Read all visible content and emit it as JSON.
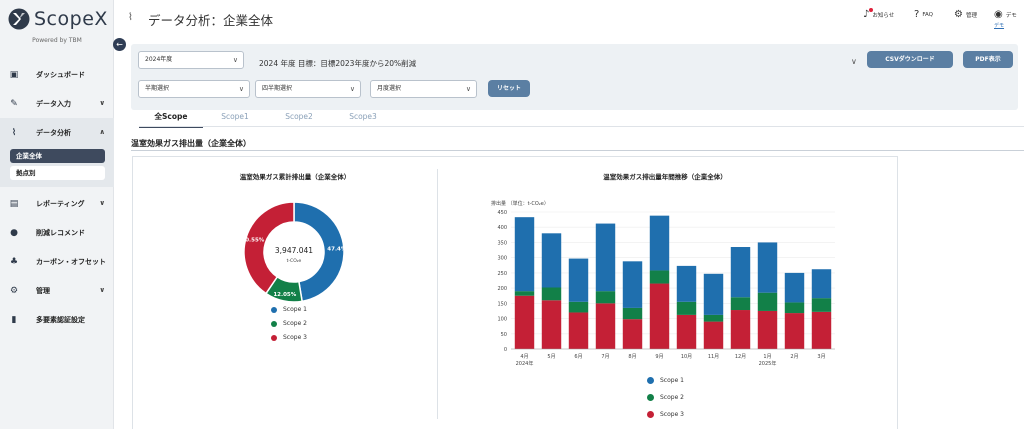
{
  "brand": {
    "name": "ScopeX",
    "powered_by": "Powered by TBM"
  },
  "sidebar": {
    "items": [
      {
        "label": "ダッシュボード"
      },
      {
        "label": "データ入力"
      },
      {
        "label": "データ分析"
      },
      {
        "label": "レポーティング"
      },
      {
        "label": "削減レコメンド"
      },
      {
        "label": "カーボン・オフセット"
      },
      {
        "label": "管理"
      },
      {
        "label": "多要素認証設定"
      }
    ],
    "sub_items": [
      {
        "label": "企業全体"
      },
      {
        "label": "拠点別"
      }
    ]
  },
  "header": {
    "title": "データ分析：企業全体",
    "notifications": "お知らせ",
    "faq": "FAQ",
    "admin": "管理",
    "user": "デモ",
    "user_sub": "デモ"
  },
  "filters": {
    "year": "2024年度",
    "goal": "2024 年度 目標：目標2023年度から20%削減",
    "half": "半期選択",
    "quarter": "四半期選択",
    "month": "月度選択",
    "reset": "リセット",
    "csv": "CSVダウンロード",
    "pdf": "PDF表示"
  },
  "tabs": [
    {
      "label": "全Scope"
    },
    {
      "label": "Scope1"
    },
    {
      "label": "Scope2"
    },
    {
      "label": "Scope3"
    }
  ],
  "section_title": "温室効果ガス排出量（企業全体）",
  "colors": {
    "scope1": "#1f6fae",
    "scope2": "#128048",
    "scope3": "#c42036"
  },
  "chart_data": [
    {
      "type": "pie",
      "title": "温室効果ガス累計排出量（企業全体）",
      "center_value": "3,947.041",
      "center_unit": "t-CO₂e",
      "labels": [
        "Scope 1",
        "Scope 2",
        "Scope 3"
      ],
      "values": [
        47.4,
        12.05,
        40.55
      ],
      "value_labels": [
        "47.4%",
        "12.05%",
        "40.55%"
      ]
    },
    {
      "type": "bar",
      "stacked": true,
      "title": "温室効果ガス排出量年間推移（企業全体）",
      "ylabel": "排出量 （単位：t-CO₂e）",
      "ylim": [
        0,
        450
      ],
      "yticks": [
        0,
        50,
        100,
        150,
        200,
        250,
        300,
        350,
        400,
        450
      ],
      "categories": [
        "4月",
        "5月",
        "6月",
        "7月",
        "8月",
        "9月",
        "10月",
        "11月",
        "12月",
        "1月",
        "2月",
        "3月"
      ],
      "category_sublabels": [
        "2024年",
        "",
        "",
        "",
        "",
        "",
        "",
        "",
        "",
        "2025年",
        "",
        ""
      ],
      "series": [
        {
          "name": "Scope 3",
          "values": [
            175,
            160,
            120,
            150,
            98,
            215,
            112,
            90,
            128,
            125,
            118,
            122
          ]
        },
        {
          "name": "Scope 2",
          "values": [
            15,
            42,
            35,
            40,
            37,
            43,
            43,
            22,
            42,
            60,
            35,
            45
          ]
        },
        {
          "name": "Scope 1",
          "values": [
            243,
            178,
            142,
            222,
            153,
            180,
            118,
            135,
            165,
            165,
            97,
            95
          ]
        }
      ]
    }
  ]
}
